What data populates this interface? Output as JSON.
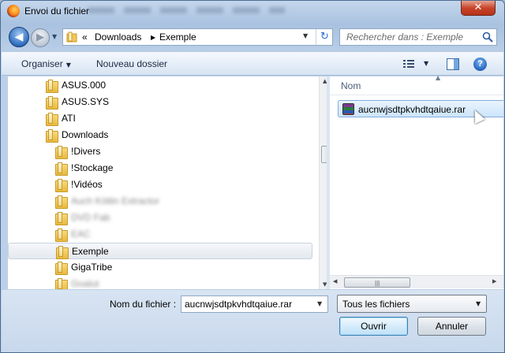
{
  "window": {
    "title": "Envoi du fichier",
    "close_label": "✕"
  },
  "nav": {
    "back_glyph": "◀",
    "forward_glyph": "▶",
    "address": {
      "prefix": "«",
      "crumbs": [
        "Downloads",
        "Exemple"
      ],
      "separator": "▶"
    },
    "search_placeholder": "Rechercher dans : Exemple"
  },
  "toolbar": {
    "organize_label": "Organiser",
    "new_folder_label": "Nouveau dossier",
    "help_label": "?"
  },
  "tree": {
    "items": [
      {
        "label": "ASUS.000",
        "indent": 1,
        "blurred": false
      },
      {
        "label": "ASUS.SYS",
        "indent": 1,
        "blurred": false
      },
      {
        "label": "ATI",
        "indent": 1,
        "blurred": false
      },
      {
        "label": "Downloads",
        "indent": 1,
        "blurred": false
      },
      {
        "label": "!Divers",
        "indent": 2,
        "blurred": false
      },
      {
        "label": "!Stockage",
        "indent": 2,
        "blurred": false
      },
      {
        "label": "!Vidéos",
        "indent": 2,
        "blurred": false
      },
      {
        "label": "Auch Kötlin Extractor",
        "indent": 2,
        "blurred": true
      },
      {
        "label": "DVD Fab",
        "indent": 2,
        "blurred": true
      },
      {
        "label": "EAC",
        "indent": 2,
        "blurred": true
      },
      {
        "label": "Exemple",
        "indent": 2,
        "blurred": false,
        "selected": true
      },
      {
        "label": "GigaTribe",
        "indent": 2,
        "blurred": false
      },
      {
        "label": "Goalut",
        "indent": 2,
        "blurred": true
      }
    ]
  },
  "list": {
    "column_name": "Nom",
    "files": [
      {
        "name": "aucnwjsdtpkvhdtqaiue.rar",
        "icon": "rar-archive-icon"
      }
    ]
  },
  "bottom": {
    "filename_label": "Nom du fichier :",
    "filename_value": "aucnwjsdtpkvhdtqaiue.rar",
    "filetype_value": "Tous les fichiers",
    "open_label": "Ouvrir",
    "cancel_label": "Annuler"
  }
}
